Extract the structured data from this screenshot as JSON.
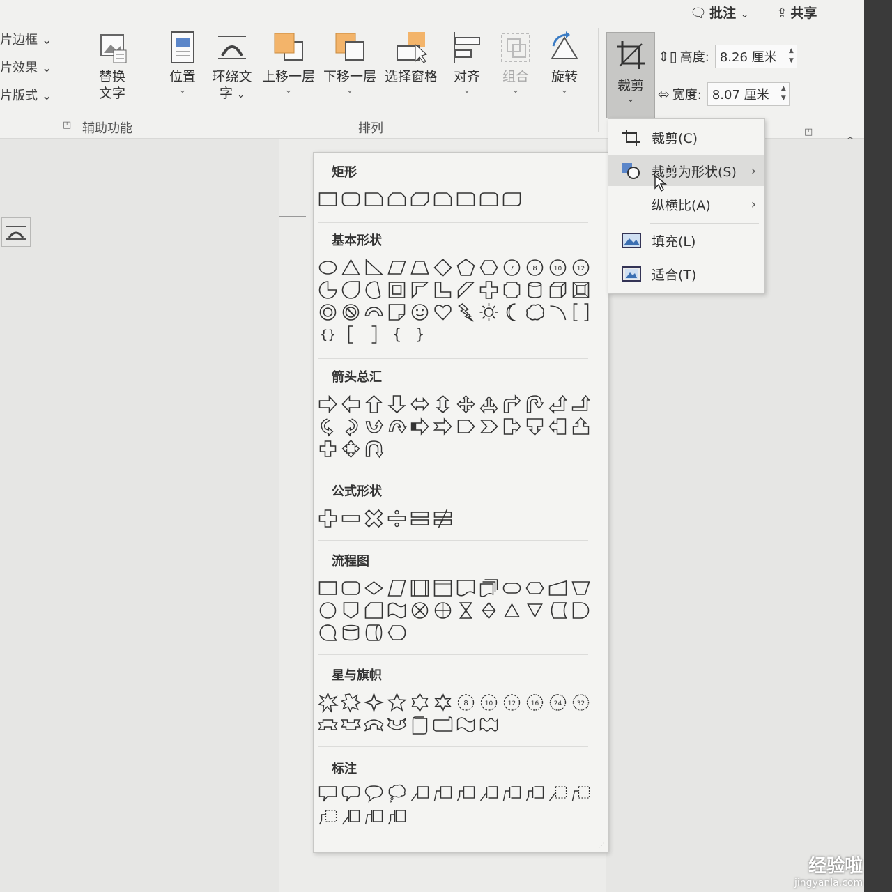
{
  "ribbon": {
    "top_actions": {
      "comment": "批注",
      "share": "共享"
    },
    "picture_menu": [
      "片边框",
      "片效果",
      "片版式"
    ],
    "alt_text": {
      "line1": "替换",
      "line2": "文字"
    },
    "group_accessibility": "辅助功能",
    "group_arrange": "排列",
    "tools": {
      "position": "位置",
      "wrap_line1": "环绕文",
      "wrap_line2": "字",
      "bring_forward": "上移一层",
      "send_backward": "下移一层",
      "selection_pane": "选择窗格",
      "align": "对齐",
      "group": "组合",
      "rotate": "旋转",
      "crop": "裁剪"
    },
    "size": {
      "height_label": "高度:",
      "height_value": "8.26 厘米",
      "width_label": "宽度:",
      "width_value": "8.07 厘米"
    }
  },
  "context_menu": {
    "items": [
      "裁剪(C)",
      "裁剪为形状(S)",
      "纵横比(A)",
      "填充(L)",
      "适合(T)"
    ]
  },
  "shape_panel": {
    "sections": [
      "矩形",
      "基本形状",
      "箭头总汇",
      "公式形状",
      "流程图",
      "星与旗帜",
      "标注"
    ]
  },
  "watermark": {
    "text": "经验啦",
    "url": "jingyanla.com"
  }
}
